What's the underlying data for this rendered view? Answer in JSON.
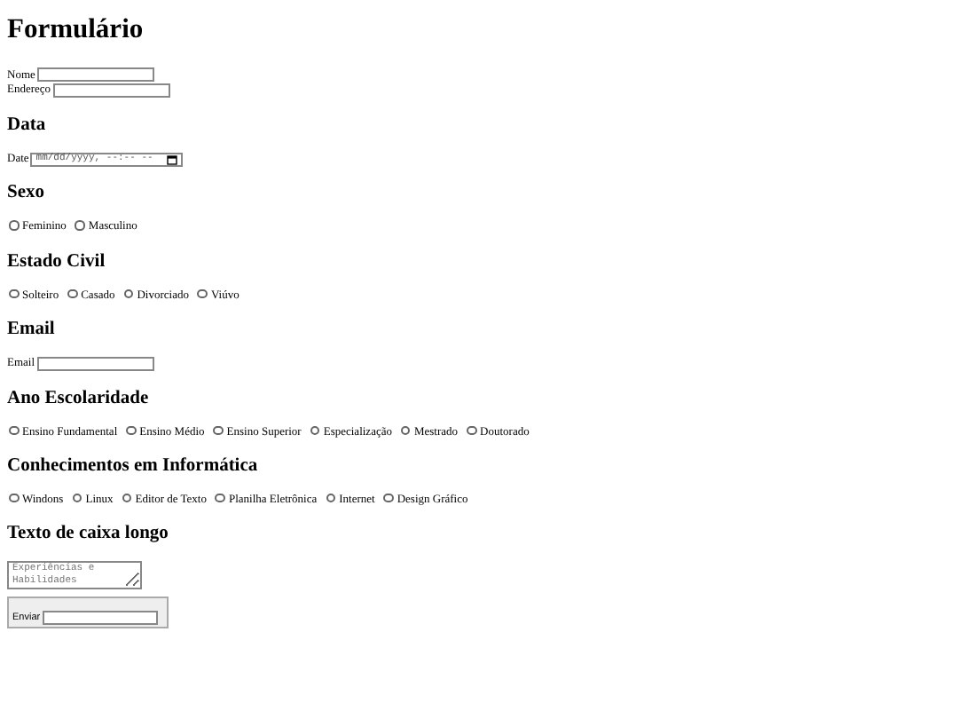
{
  "title": "Formulário",
  "fields": [
    {
      "label": "Nome"
    },
    {
      "label": "Endereço"
    }
  ],
  "sections": [
    {
      "heading": "Data",
      "kind": "datetime",
      "label": "Date",
      "placeholder": "mm/dd/yyyy, --:-- --"
    },
    {
      "heading": "Sexo",
      "kind": "radios",
      "options": [
        {
          "label": "Feminino",
          "selected": false
        },
        {
          "label": "Masculino",
          "selected": false
        }
      ]
    },
    {
      "heading": "Estado Civil",
      "kind": "radios",
      "options": [
        {
          "label": "Solteiro",
          "selected": false
        },
        {
          "label": "Casado",
          "selected": false
        },
        {
          "label": "Divorciado",
          "selected": false
        },
        {
          "label": "Viúvo",
          "selected": false
        }
      ]
    },
    {
      "heading": "Email",
      "kind": "text",
      "label": "Email"
    },
    {
      "heading": "Ano Escolaridade",
      "kind": "radios",
      "options": [
        {
          "label": "Ensino Fundamental",
          "selected": false
        },
        {
          "label": "Ensino Médio",
          "selected": false
        },
        {
          "label": "Ensino Superior",
          "selected": false
        },
        {
          "label": "Especialização",
          "selected": false
        },
        {
          "label": "Mestrado",
          "selected": false
        },
        {
          "label": "Doutorado",
          "selected": false
        }
      ]
    },
    {
      "heading": "Conhecimentos em Informática",
      "kind": "radios",
      "options": [
        {
          "label": "Windons",
          "selected": false
        },
        {
          "label": "Linux",
          "selected": false
        },
        {
          "label": "Editor de Texto",
          "selected": false
        },
        {
          "label": "Planilha Eletrônica",
          "selected": false
        },
        {
          "label": "Internet",
          "selected": false
        },
        {
          "label": "Design Gráfico",
          "selected": false
        }
      ]
    },
    {
      "heading": "Texto de caixa longo",
      "kind": "textarea",
      "placeholder": "Experiências e Habilidades"
    }
  ],
  "submit": {
    "label": "Enviar"
  }
}
